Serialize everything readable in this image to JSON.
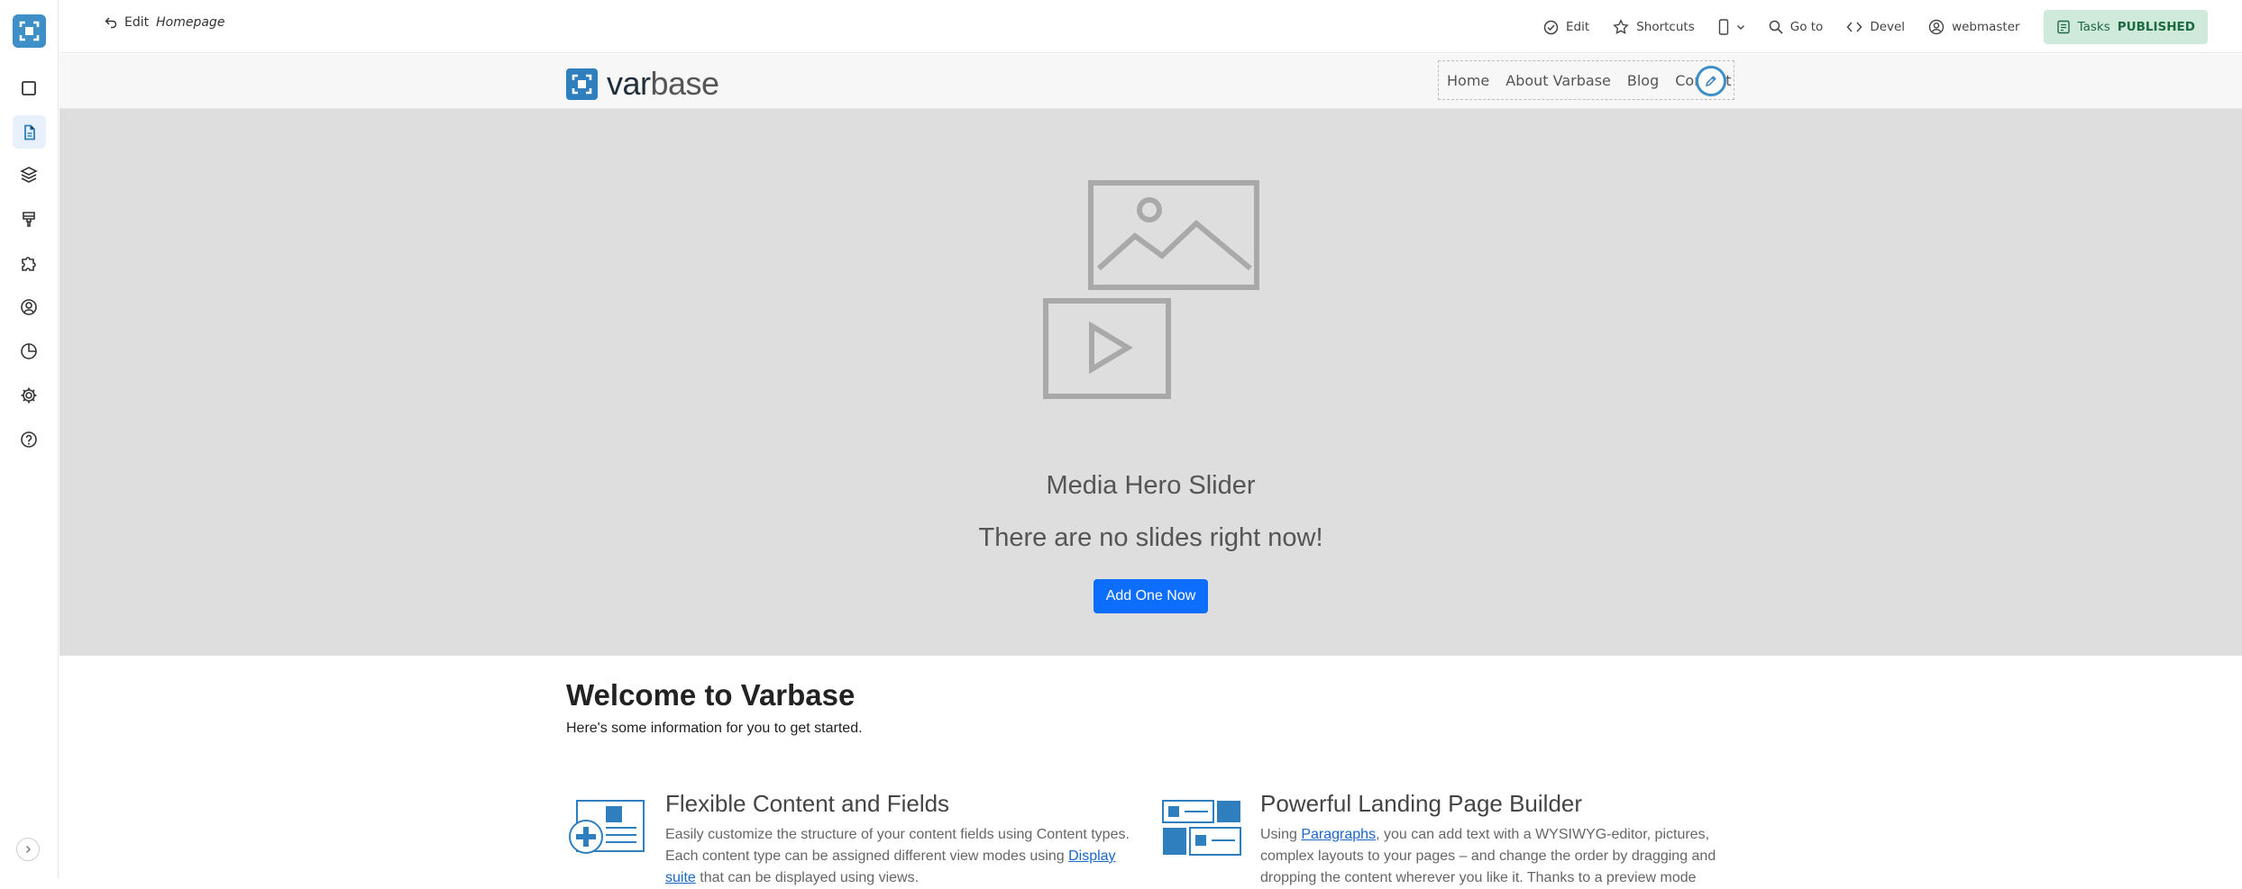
{
  "toolbar": {
    "edit_prefix": "Edit",
    "edit_page": "Homepage",
    "edit": "Edit",
    "shortcuts": "Shortcuts",
    "goto": "Go to",
    "devel": "Devel",
    "user": "webmaster",
    "tasks": "Tasks",
    "status": "PUBLISHED"
  },
  "site": {
    "brand_var": "var",
    "brand_base": "base",
    "nav": [
      "Home",
      "About Varbase",
      "Blog",
      "Contact"
    ]
  },
  "hero": {
    "title": "Media Hero Slider",
    "subtitle": "There are no slides right now!",
    "button": "Add One Now"
  },
  "content": {
    "welcome_title": "Welcome to Varbase",
    "welcome_sub": "Here's some information for you to get started.",
    "features": [
      {
        "title": "Flexible Content and Fields",
        "text_before": "Easily customize the structure of your content fields using Content types. Each content type can be assigned different view modes using ",
        "link": "Display suite",
        "text_after": " that can be displayed using views."
      },
      {
        "title": "Powerful Landing Page Builder",
        "text_before": "Using ",
        "link": "Paragraphs",
        "text_after": ", you can add text with a WYSIWYG-editor, pictures, complex layouts to your pages – and change the order by dragging and dropping the content wherever you like it. Thanks to a preview mode"
      }
    ]
  },
  "icons": {
    "sidebar": [
      "blocks-icon",
      "content-icon",
      "structure-icon",
      "appearance-icon",
      "extend-icon",
      "people-icon",
      "reports-icon",
      "configuration-icon",
      "help-icon"
    ]
  },
  "colors": {
    "accent": "#3e8fc7",
    "primary_button": "#0d6efd",
    "published_bg": "#cfeadb",
    "hero_bg": "#dedede"
  }
}
